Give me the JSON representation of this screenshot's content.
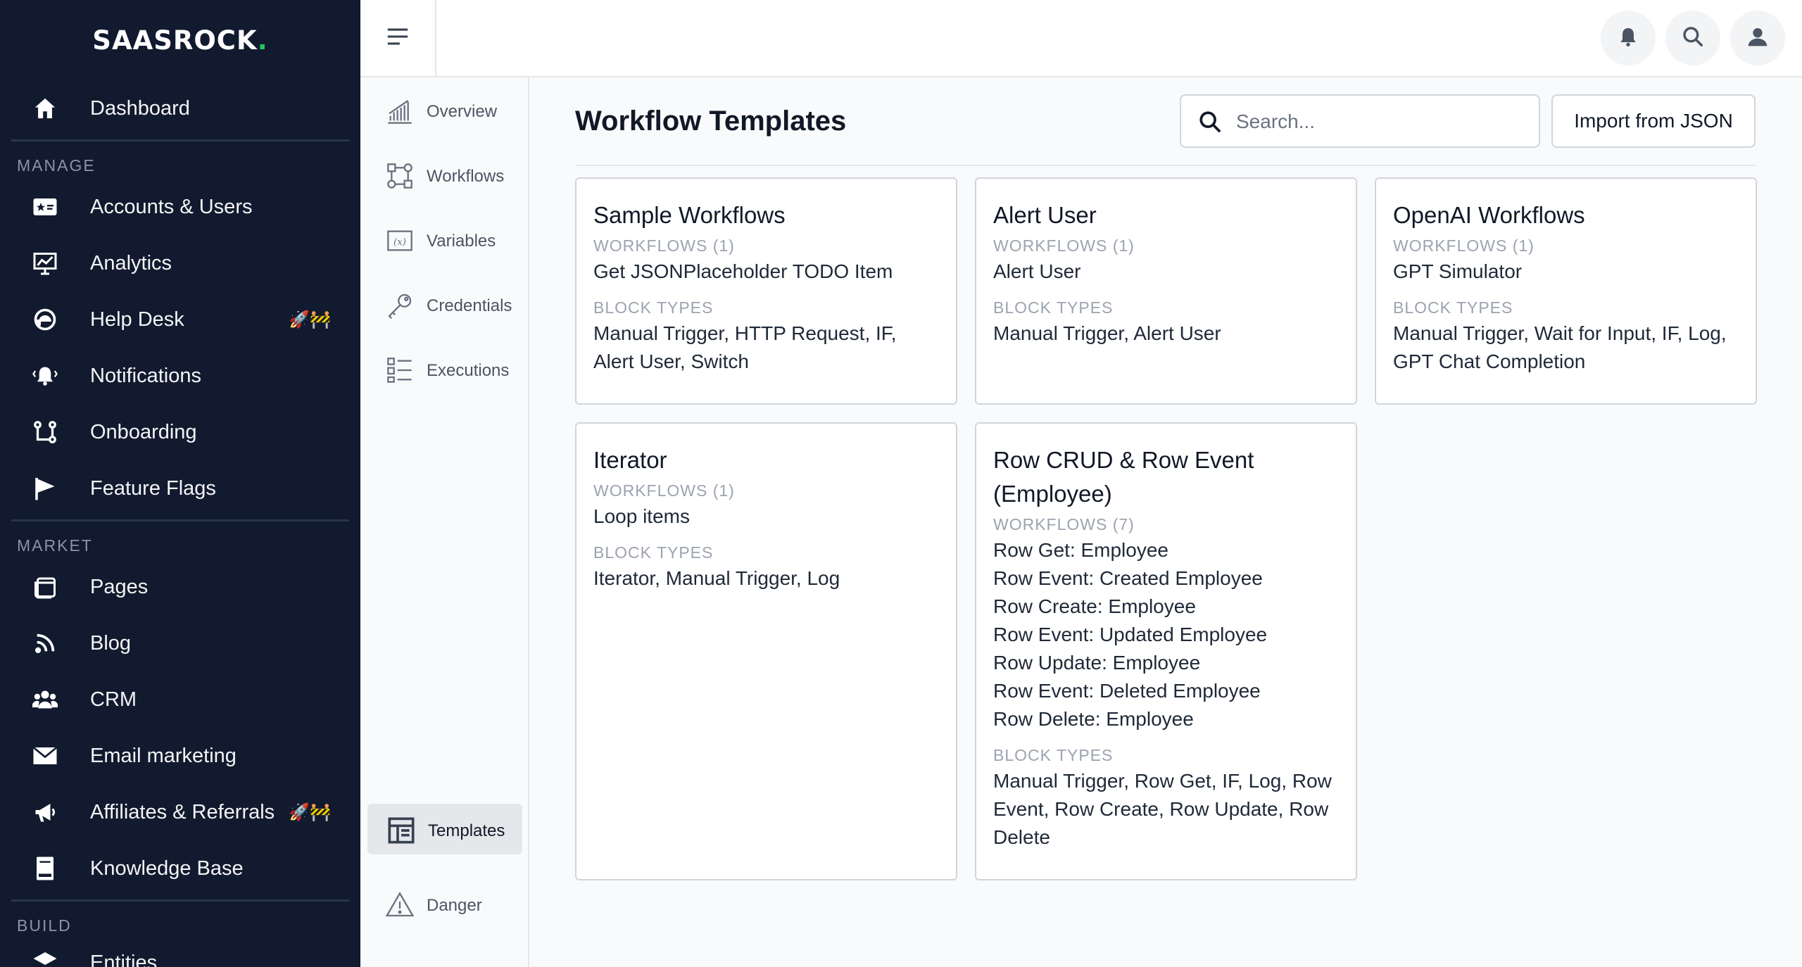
{
  "brand": {
    "name": "SAASROCK",
    "dot": "."
  },
  "sidebar": {
    "dashboard": "Dashboard",
    "sections": {
      "manage": "MANAGE",
      "market": "MARKET",
      "build": "BUILD"
    },
    "items": [
      {
        "label": "Dashboard"
      },
      {
        "label": "Accounts & Users"
      },
      {
        "label": "Analytics"
      },
      {
        "label": "Help Desk",
        "badge": "🚀🚧"
      },
      {
        "label": "Notifications"
      },
      {
        "label": "Onboarding"
      },
      {
        "label": "Feature Flags"
      },
      {
        "label": "Pages"
      },
      {
        "label": "Blog"
      },
      {
        "label": "CRM"
      },
      {
        "label": "Email marketing"
      },
      {
        "label": "Affiliates & Referrals",
        "badge": "🚀🚧"
      },
      {
        "label": "Knowledge Base"
      },
      {
        "label": "Entities"
      }
    ]
  },
  "subnav": {
    "items": [
      {
        "label": "Overview"
      },
      {
        "label": "Workflows"
      },
      {
        "label": "Variables"
      },
      {
        "label": "Credentials"
      },
      {
        "label": "Executions"
      },
      {
        "label": "Templates"
      },
      {
        "label": "Danger"
      }
    ],
    "variables_icon_text": "(x)"
  },
  "main": {
    "title": "Workflow Templates",
    "search_placeholder": "Search...",
    "import_label": "Import from JSON",
    "cards": [
      {
        "title": "Sample Workflows",
        "workflows_heading": "WORKFLOWS (1)",
        "workflows": [
          "Get JSONPlaceholder TODO Item"
        ],
        "block_types_heading": "BLOCK TYPES",
        "block_types": [
          "Manual Trigger, HTTP Request, IF,",
          "Alert User, Switch"
        ]
      },
      {
        "title": "Alert User",
        "workflows_heading": "WORKFLOWS (1)",
        "workflows": [
          "Alert User"
        ],
        "block_types_heading": "BLOCK TYPES",
        "block_types": [
          "Manual Trigger, Alert User"
        ]
      },
      {
        "title": "OpenAI Workflows",
        "workflows_heading": "WORKFLOWS (1)",
        "workflows": [
          "GPT Simulator"
        ],
        "block_types_heading": "BLOCK TYPES",
        "block_types": [
          "Manual Trigger, Wait for Input, IF, Log,",
          "GPT Chat Completion"
        ]
      },
      {
        "title": "Iterator",
        "workflows_heading": "WORKFLOWS (1)",
        "workflows": [
          "Loop items"
        ],
        "block_types_heading": "BLOCK TYPES",
        "block_types": [
          "Iterator, Manual Trigger, Log"
        ]
      },
      {
        "title": "Row CRUD & Row Event (Employee)",
        "title_lines": [
          "Row CRUD & Row Event",
          "(Employee)"
        ],
        "workflows_heading": "WORKFLOWS (7)",
        "workflows": [
          "Row Get: Employee",
          "Row Event: Created Employee",
          "Row Create: Employee",
          "Row Event: Updated Employee",
          "Row Update: Employee",
          "Row Event: Deleted Employee",
          "Row Delete: Employee"
        ],
        "block_types_heading": "BLOCK TYPES",
        "block_types": [
          "Manual Trigger, Row Get, IF, Log, Row",
          "Event, Row Create, Row Update, Row",
          "Delete"
        ]
      }
    ]
  },
  "colors": {
    "sidebar_bg": "#111a2e",
    "brand_dot": "#22c55e",
    "border": "#d1d5db",
    "muted_text": "#9ca3af"
  },
  "icons": {
    "topbar": [
      "menu-icon",
      "bell-icon",
      "search-icon",
      "user-icon"
    ]
  }
}
